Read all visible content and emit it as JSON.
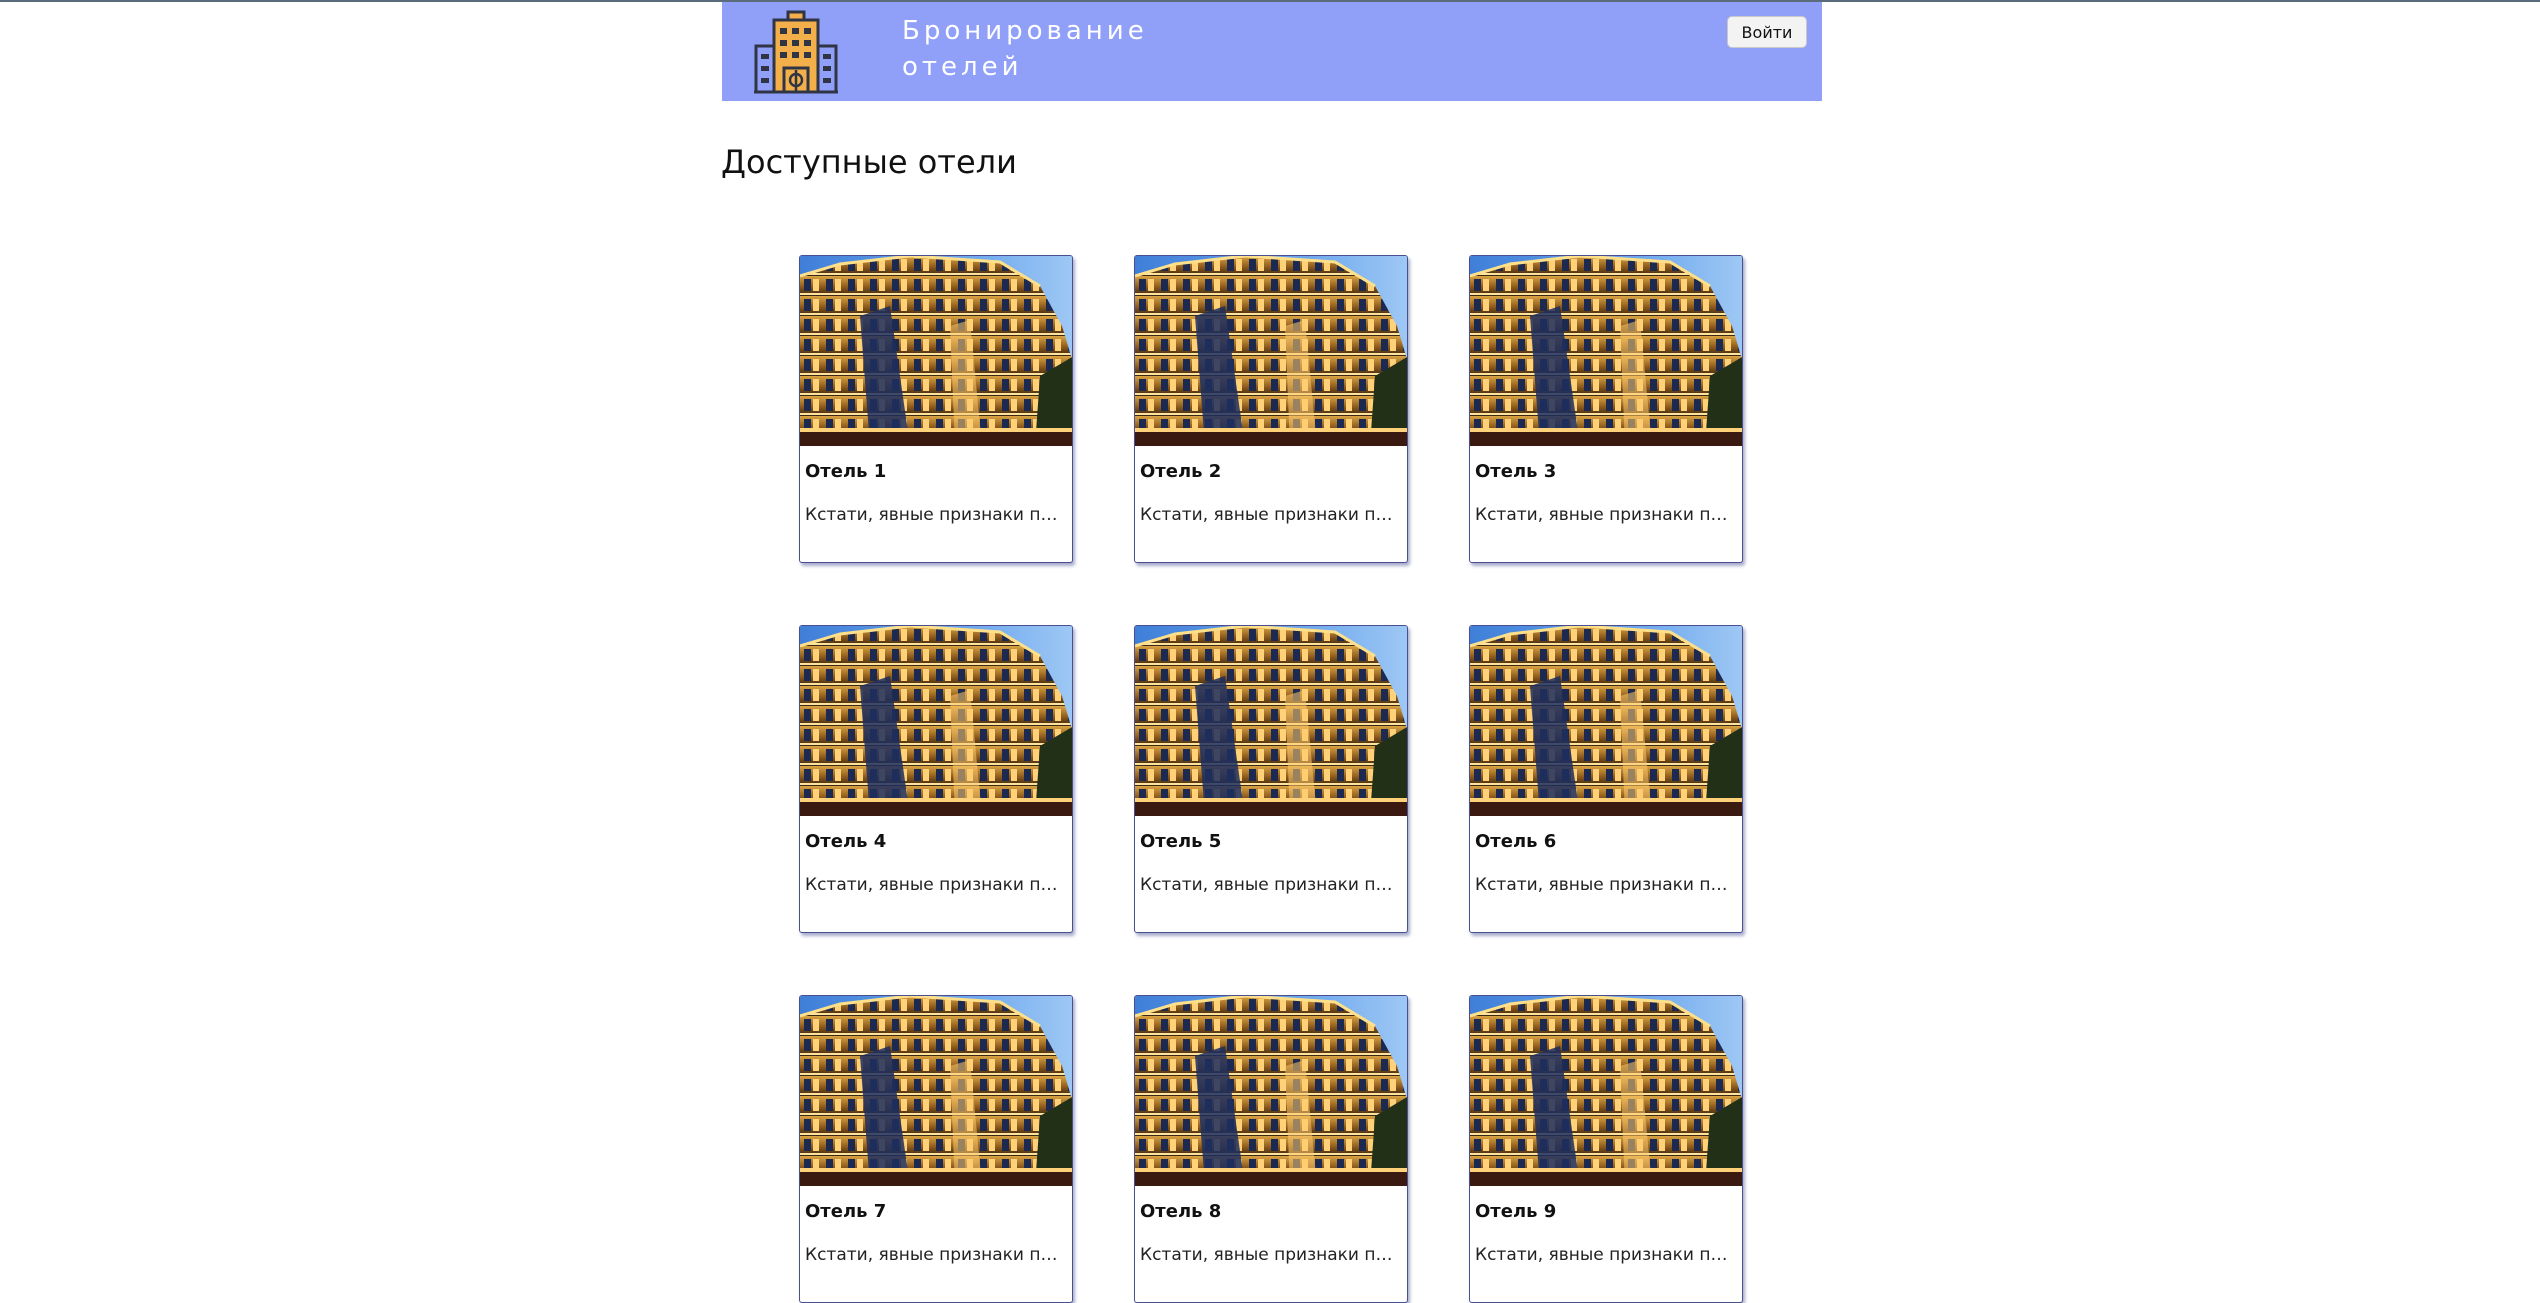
{
  "header": {
    "brand": "Бронирование\nотелей",
    "login_label": "Войти",
    "logo_icon": "hotel-building-icon",
    "background": "#909ff7"
  },
  "main": {
    "title": "Доступные отели"
  },
  "hotels": [
    {
      "name": "Отель 1",
      "description": "Кстати, явные признаки победы"
    },
    {
      "name": "Отель 2",
      "description": "Кстати, явные признаки победы"
    },
    {
      "name": "Отель 3",
      "description": "Кстати, явные признаки победы"
    },
    {
      "name": "Отель 4",
      "description": "Кстати, явные признаки победы"
    },
    {
      "name": "Отель 5",
      "description": "Кстати, явные признаки победы"
    },
    {
      "name": "Отель 6",
      "description": "Кстати, явные признаки победы"
    },
    {
      "name": "Отель 7",
      "description": "Кстати, явные признаки победы"
    },
    {
      "name": "Отель 8",
      "description": "Кстати, явные признаки победы"
    },
    {
      "name": "Отель 9",
      "description": "Кстати, явные признаки победы"
    }
  ]
}
